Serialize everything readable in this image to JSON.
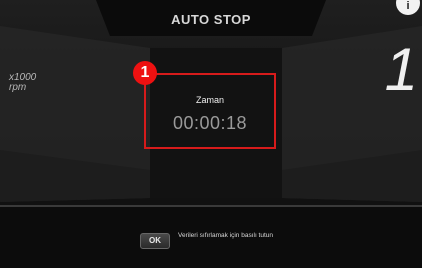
{
  "screen": {
    "title": "AUTO STOP",
    "corner_icon_glyph": "i",
    "rpm_label_line1": "x1000",
    "rpm_label_line2": "rpm",
    "gear_value": "1"
  },
  "callout": {
    "number": "1",
    "color": "#d61b1b"
  },
  "timer": {
    "label": "Zaman",
    "value": "00:00:18"
  },
  "footer": {
    "ok_label": "OK",
    "hint": "Verileri sıfırlamak için basılı tutun"
  }
}
